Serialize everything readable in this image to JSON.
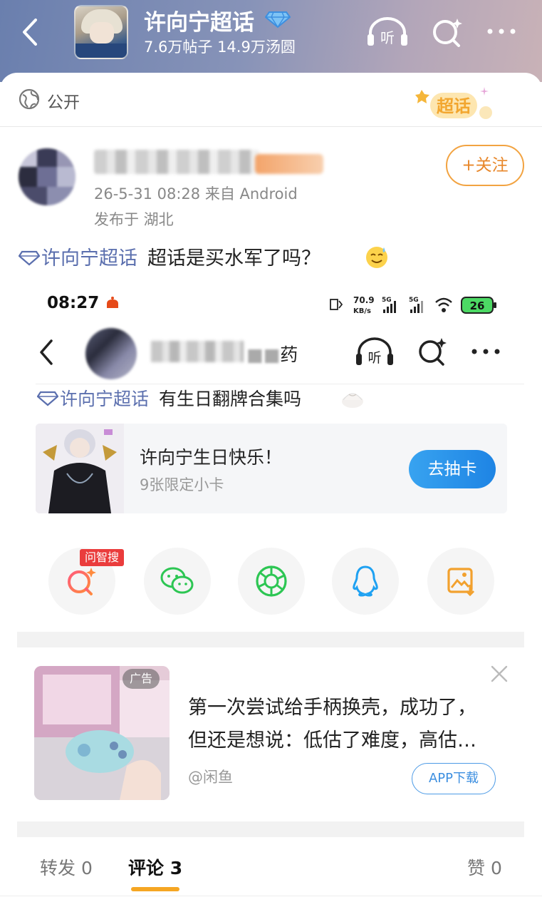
{
  "header": {
    "topic_title": "许向宁超话",
    "stats": "7.6万帖子 14.9万汤圆",
    "listen_label": "听"
  },
  "public_row": {
    "label": "公开",
    "badge_text": "超话"
  },
  "post": {
    "time": "26-5-31 08:28  来自 Android",
    "location": "发布于 湖北",
    "follow_label": "+关注",
    "topic": "许向宁超话",
    "text": "超话是买水军了吗？"
  },
  "embedded_screenshot": {
    "status_time": "08:27",
    "network_speed": "70.9 KB/s",
    "battery": "26",
    "name_suffix": "药",
    "listen_label": "听",
    "topic": "许向宁超话",
    "text": "有生日翻牌合集吗",
    "promo": {
      "title": "许向宁生日快乐！",
      "subtitle": "9张限定小卡",
      "button": "去抽卡"
    },
    "ask_tag": "问智搜",
    "share_icons": [
      "ai-search-icon",
      "wechat-icon",
      "moments-icon",
      "qq-icon",
      "save-image-icon"
    ]
  },
  "ad": {
    "tag": "广告",
    "line1": "第一次尝试给手柄换壳，成功了，",
    "line2": "但还是想说：低估了难度，高估…",
    "source": "@闲鱼",
    "button": "APP下载"
  },
  "tabs": {
    "repost": "转发 0",
    "comment": "评论 3",
    "like": "赞 0"
  },
  "colors": {
    "accent_orange": "#f5a623",
    "topic_blue": "#5b6fae",
    "button_blue": "#1e84e4"
  }
}
